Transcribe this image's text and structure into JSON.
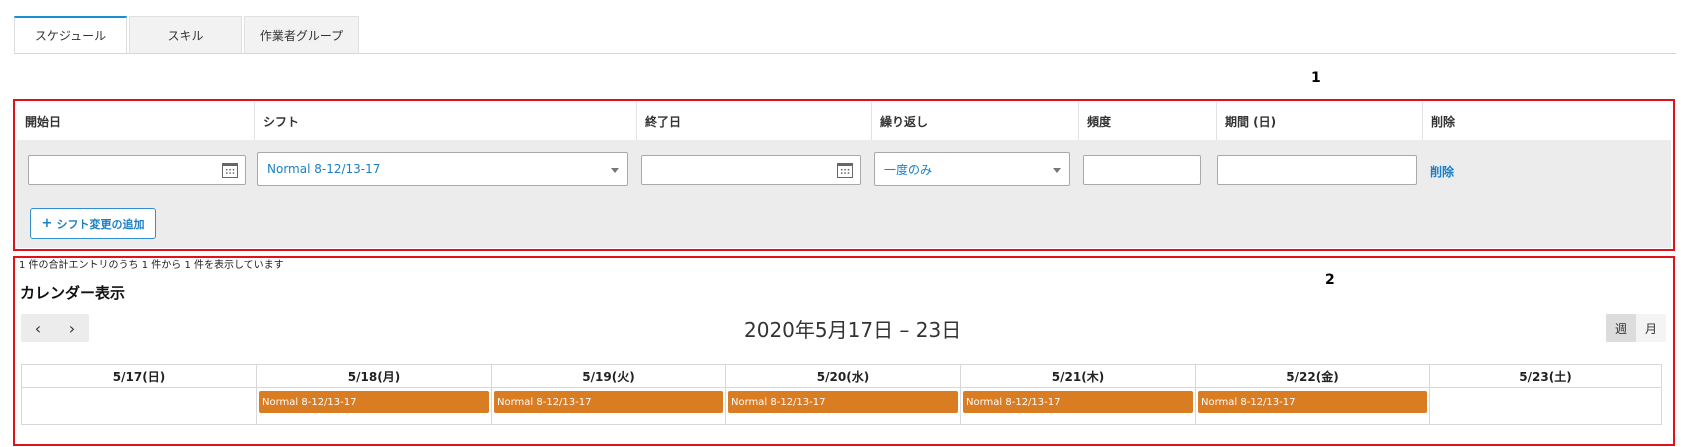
{
  "tabs": [
    {
      "label": "スケジュール",
      "active": true
    },
    {
      "label": "スキル",
      "active": false
    },
    {
      "label": "作業者グループ",
      "active": false
    }
  ],
  "markers": {
    "one": "1",
    "two": "2"
  },
  "shift_table": {
    "headers": {
      "start_date": "開始日",
      "shift": "シフト",
      "end_date": "終了日",
      "repeat": "繰り返し",
      "frequency": "頻度",
      "period": "期間 (日)",
      "delete": "削除"
    },
    "row": {
      "start_date": "",
      "shift": "Normal 8-12/13-17",
      "end_date": "",
      "repeat": "一度のみ",
      "frequency": "",
      "period": "",
      "delete_link": "削除"
    },
    "add_button": "シフト変更の追加"
  },
  "entry_info": "1 件の合計エントリのうち 1 件から 1 件を表示しています",
  "calendar": {
    "title": "カレンダー表示",
    "prev_icon": "‹",
    "next_icon": "›",
    "range": "2020年5月17日 – 23日",
    "views": [
      {
        "label": "週",
        "active": true
      },
      {
        "label": "月",
        "active": false
      }
    ],
    "days": [
      {
        "label": "5/17(日)",
        "event": ""
      },
      {
        "label": "5/18(月)",
        "event": "Normal 8-12/13-17"
      },
      {
        "label": "5/19(火)",
        "event": "Normal 8-12/13-17"
      },
      {
        "label": "5/20(水)",
        "event": "Normal 8-12/13-17"
      },
      {
        "label": "5/21(木)",
        "event": "Normal 8-12/13-17"
      },
      {
        "label": "5/22(金)",
        "event": "Normal 8-12/13-17"
      },
      {
        "label": "5/23(土)",
        "event": ""
      }
    ],
    "event_color": "#d97c22"
  },
  "colors": {
    "accent": "#1a7fc4",
    "highlight_border": "#e0121b"
  }
}
